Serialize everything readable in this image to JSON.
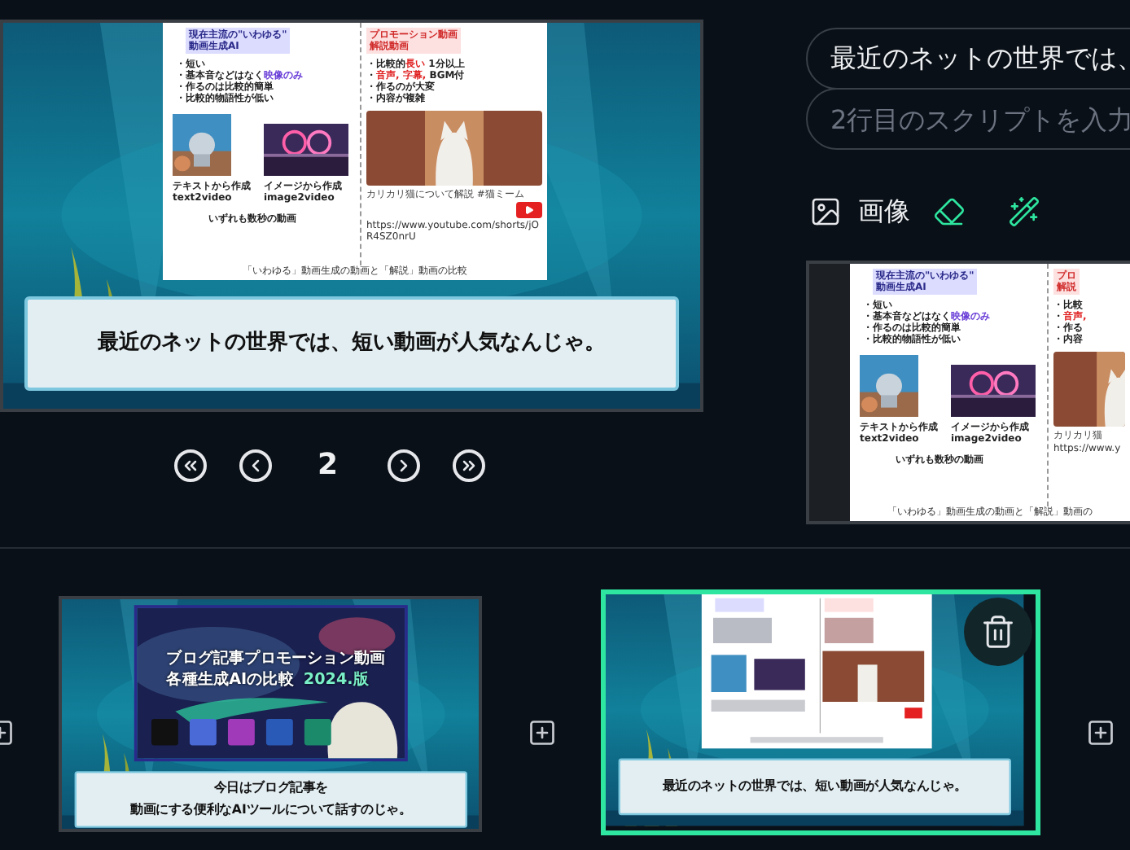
{
  "preview": {
    "slide": {
      "left_heading": [
        "現在主流の\"いわゆる\"",
        "動画生成AI"
      ],
      "left_bullets": [
        [
          {
            "text": "・短い"
          }
        ],
        [
          {
            "text": "・基本音などはなく"
          },
          {
            "text": "映像のみ",
            "emphasis": true
          }
        ],
        [
          {
            "text": "・作るのは比較的簡単"
          }
        ],
        [
          {
            "text": "・比較的物語性が低い"
          }
        ]
      ],
      "media": [
        {
          "caption": [
            "テキストから作成",
            "text2video"
          ]
        },
        {
          "caption": [
            "イメージから作成",
            "image2video"
          ]
        }
      ],
      "note": "いずれも数秒の動画",
      "right_heading": [
        "プロモーション動画",
        "解説動画"
      ],
      "right_bullets": [
        [
          {
            "text": "・比較的"
          },
          {
            "text": "長い",
            "emphasis": true
          },
          {
            "text": " 1分以上"
          }
        ],
        [
          {
            "text": "・"
          },
          {
            "text": "音声, 字幕,",
            "emphasis": true
          },
          {
            "text": " BGM付"
          }
        ],
        [
          {
            "text": "・作るのが大変"
          }
        ],
        [
          {
            "text": "・内容が複雑"
          }
        ]
      ],
      "video_title": "カリカリ猫について解説 #猫ミーム",
      "video_logo": true,
      "url": "https://www.youtube.com/shorts/jOR4SZ0nrU",
      "footer": "「いわゆる」動画生成の動画と「解説」動画の比較"
    },
    "caption": [
      "最近のネットの世界では、短い動画が人気なんじゃ。"
    ]
  },
  "pager": {
    "page": "2"
  },
  "script_fields": [
    {
      "value": "最近のネットの世界では、"
    },
    {
      "placeholder": "2行目のスクリプトを入力"
    }
  ],
  "image_section": {
    "label": "画像",
    "slide": {
      "left_heading": [
        "現在主流の\"いわゆる\"",
        "動画生成AI"
      ],
      "left_bullets": [
        [
          {
            "text": "・短い"
          }
        ],
        [
          {
            "text": "・基本音などはなく"
          },
          {
            "text": "映像のみ",
            "emphasis": true
          }
        ],
        [
          {
            "text": "・作るのは比較的簡単"
          }
        ],
        [
          {
            "text": "・比較的物語性が低い"
          }
        ]
      ],
      "media": [
        {
          "caption": [
            "テキストから作成",
            "text2video"
          ]
        },
        {
          "caption": [
            "イメージから作成",
            "image2video"
          ]
        }
      ],
      "note": "いずれも数秒の動画",
      "right_heading": [
        "プロ",
        "解説"
      ],
      "right_bullets": [
        [
          {
            "text": "・比較"
          }
        ],
        [
          {
            "text": "・"
          },
          {
            "text": "音声,",
            "emphasis": true
          }
        ],
        [
          {
            "text": "・作る"
          }
        ],
        [
          {
            "text": "・内容"
          }
        ]
      ],
      "video_title": "カリカリ猫",
      "video_logo": false,
      "url": "https://www.y",
      "footer": "「いわゆる」動画生成の動画と「解説」動画の"
    }
  },
  "timeline": [
    {
      "kind": "title",
      "selected": false,
      "title": [
        "ブログ記事プロモーション動画",
        "各種生成AIの比較"
      ],
      "title_tag": "2024.版",
      "caption": [
        "今日はブログ記事を",
        "動画にする便利なAIツールについて話すのじゃ。"
      ]
    },
    {
      "kind": "content",
      "selected": true,
      "caption": [
        "最近のネットの世界では、短い動画が人気なんじゃ。"
      ]
    }
  ]
}
